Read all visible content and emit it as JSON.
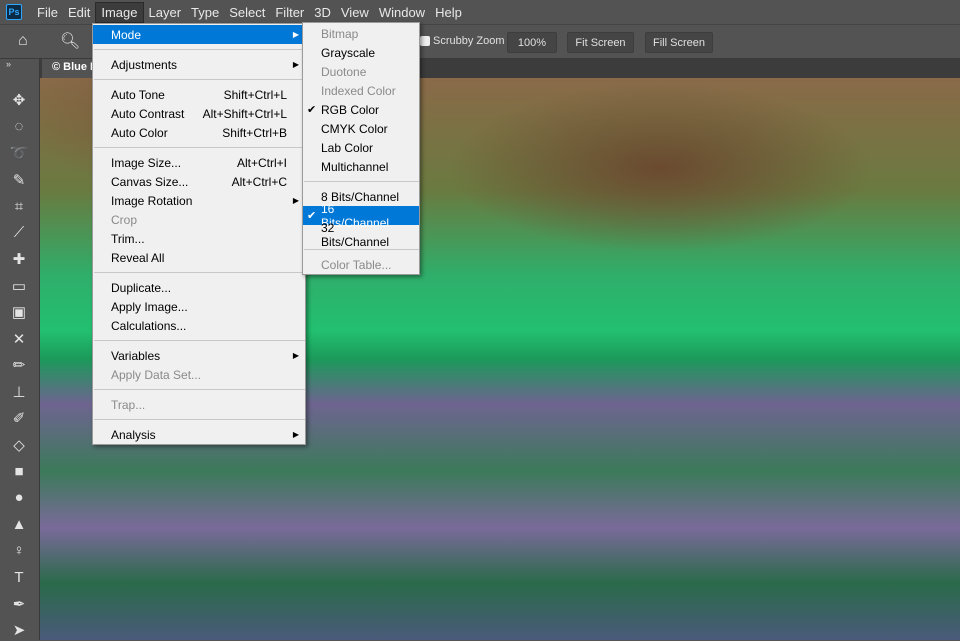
{
  "app": {
    "logo": "Ps"
  },
  "menubar": [
    "File",
    "Edit",
    "Image",
    "Layer",
    "Type",
    "Select",
    "Filter",
    "3D",
    "View",
    "Window",
    "Help"
  ],
  "options": {
    "scrubby_zoom": "Scrubby Zoom",
    "zoom_100": "100%",
    "fit_screen": "Fit Screen",
    "fill_screen": "Fill Screen"
  },
  "document_tab": "© Blue I",
  "image_menu": [
    {
      "label": "Mode",
      "submenu": true,
      "highlight": true
    },
    {
      "sep": true
    },
    {
      "label": "Adjustments",
      "submenu": true
    },
    {
      "sep": true
    },
    {
      "label": "Auto Tone",
      "shortcut": "Shift+Ctrl+L"
    },
    {
      "label": "Auto Contrast",
      "shortcut": "Alt+Shift+Ctrl+L"
    },
    {
      "label": "Auto Color",
      "shortcut": "Shift+Ctrl+B"
    },
    {
      "sep": true
    },
    {
      "label": "Image Size...",
      "shortcut": "Alt+Ctrl+I"
    },
    {
      "label": "Canvas Size...",
      "shortcut": "Alt+Ctrl+C"
    },
    {
      "label": "Image Rotation",
      "submenu": true
    },
    {
      "label": "Crop",
      "disabled": true
    },
    {
      "label": "Trim..."
    },
    {
      "label": "Reveal All"
    },
    {
      "sep": true
    },
    {
      "label": "Duplicate..."
    },
    {
      "label": "Apply Image..."
    },
    {
      "label": "Calculations..."
    },
    {
      "sep": true
    },
    {
      "label": "Variables",
      "submenu": true
    },
    {
      "label": "Apply Data Set...",
      "disabled": true
    },
    {
      "sep": true
    },
    {
      "label": "Trap...",
      "disabled": true
    },
    {
      "sep": true
    },
    {
      "label": "Analysis",
      "submenu": true
    }
  ],
  "mode_submenu": [
    {
      "label": "Bitmap",
      "disabled": true
    },
    {
      "label": "Grayscale"
    },
    {
      "label": "Duotone",
      "disabled": true
    },
    {
      "label": "Indexed Color",
      "disabled": true
    },
    {
      "label": "RGB Color",
      "checked": true
    },
    {
      "label": "CMYK Color"
    },
    {
      "label": "Lab Color"
    },
    {
      "label": "Multichannel"
    },
    {
      "sep": true
    },
    {
      "label": "8 Bits/Channel"
    },
    {
      "label": "16 Bits/Channel",
      "checked": true,
      "highlight": true
    },
    {
      "label": "32 Bits/Channel"
    },
    {
      "sep": true
    },
    {
      "label": "Color Table...",
      "disabled": true
    }
  ],
  "tools": [
    "move",
    "marquee",
    "lasso",
    "quick-selection",
    "crop",
    "eyedropper",
    "spot-healing",
    "healing",
    "patch",
    "content-aware-move",
    "brush",
    "clone-stamp",
    "history-brush",
    "eraser",
    "gradient",
    "blur",
    "sharpen",
    "dodge",
    "type",
    "pen",
    "path-selection"
  ]
}
